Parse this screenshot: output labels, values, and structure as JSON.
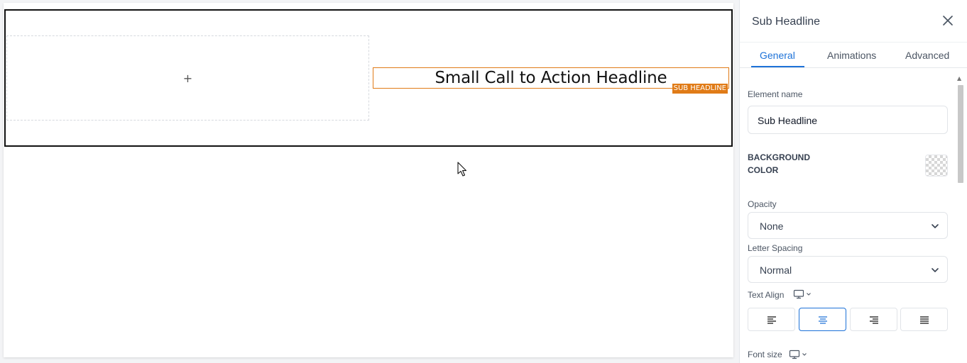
{
  "canvas": {
    "add_symbol": "+",
    "headline_text": "Small Call to Action Headline",
    "headline_tag": "SUB HEADLINE"
  },
  "panel": {
    "title": "Sub Headline",
    "tabs": [
      {
        "label": "General",
        "active": true
      },
      {
        "label": "Animations",
        "active": false
      },
      {
        "label": "Advanced",
        "active": false
      }
    ],
    "element_name": {
      "label": "Element name",
      "value": "Sub Headline"
    },
    "background_color": {
      "label_line1": "BACKGROUND",
      "label_line2": "COLOR",
      "swatch": "transparent"
    },
    "opacity": {
      "label": "Opacity",
      "value": "None"
    },
    "letter_spacing": {
      "label": "Letter Spacing",
      "value": "Normal"
    },
    "text_align": {
      "label": "Text Align",
      "options": [
        "left",
        "center",
        "right",
        "justify"
      ],
      "selected": "center"
    },
    "font_size": {
      "label": "Font size"
    }
  },
  "colors": {
    "accent": "#1d72d8",
    "selection_orange": "#e07b17"
  }
}
